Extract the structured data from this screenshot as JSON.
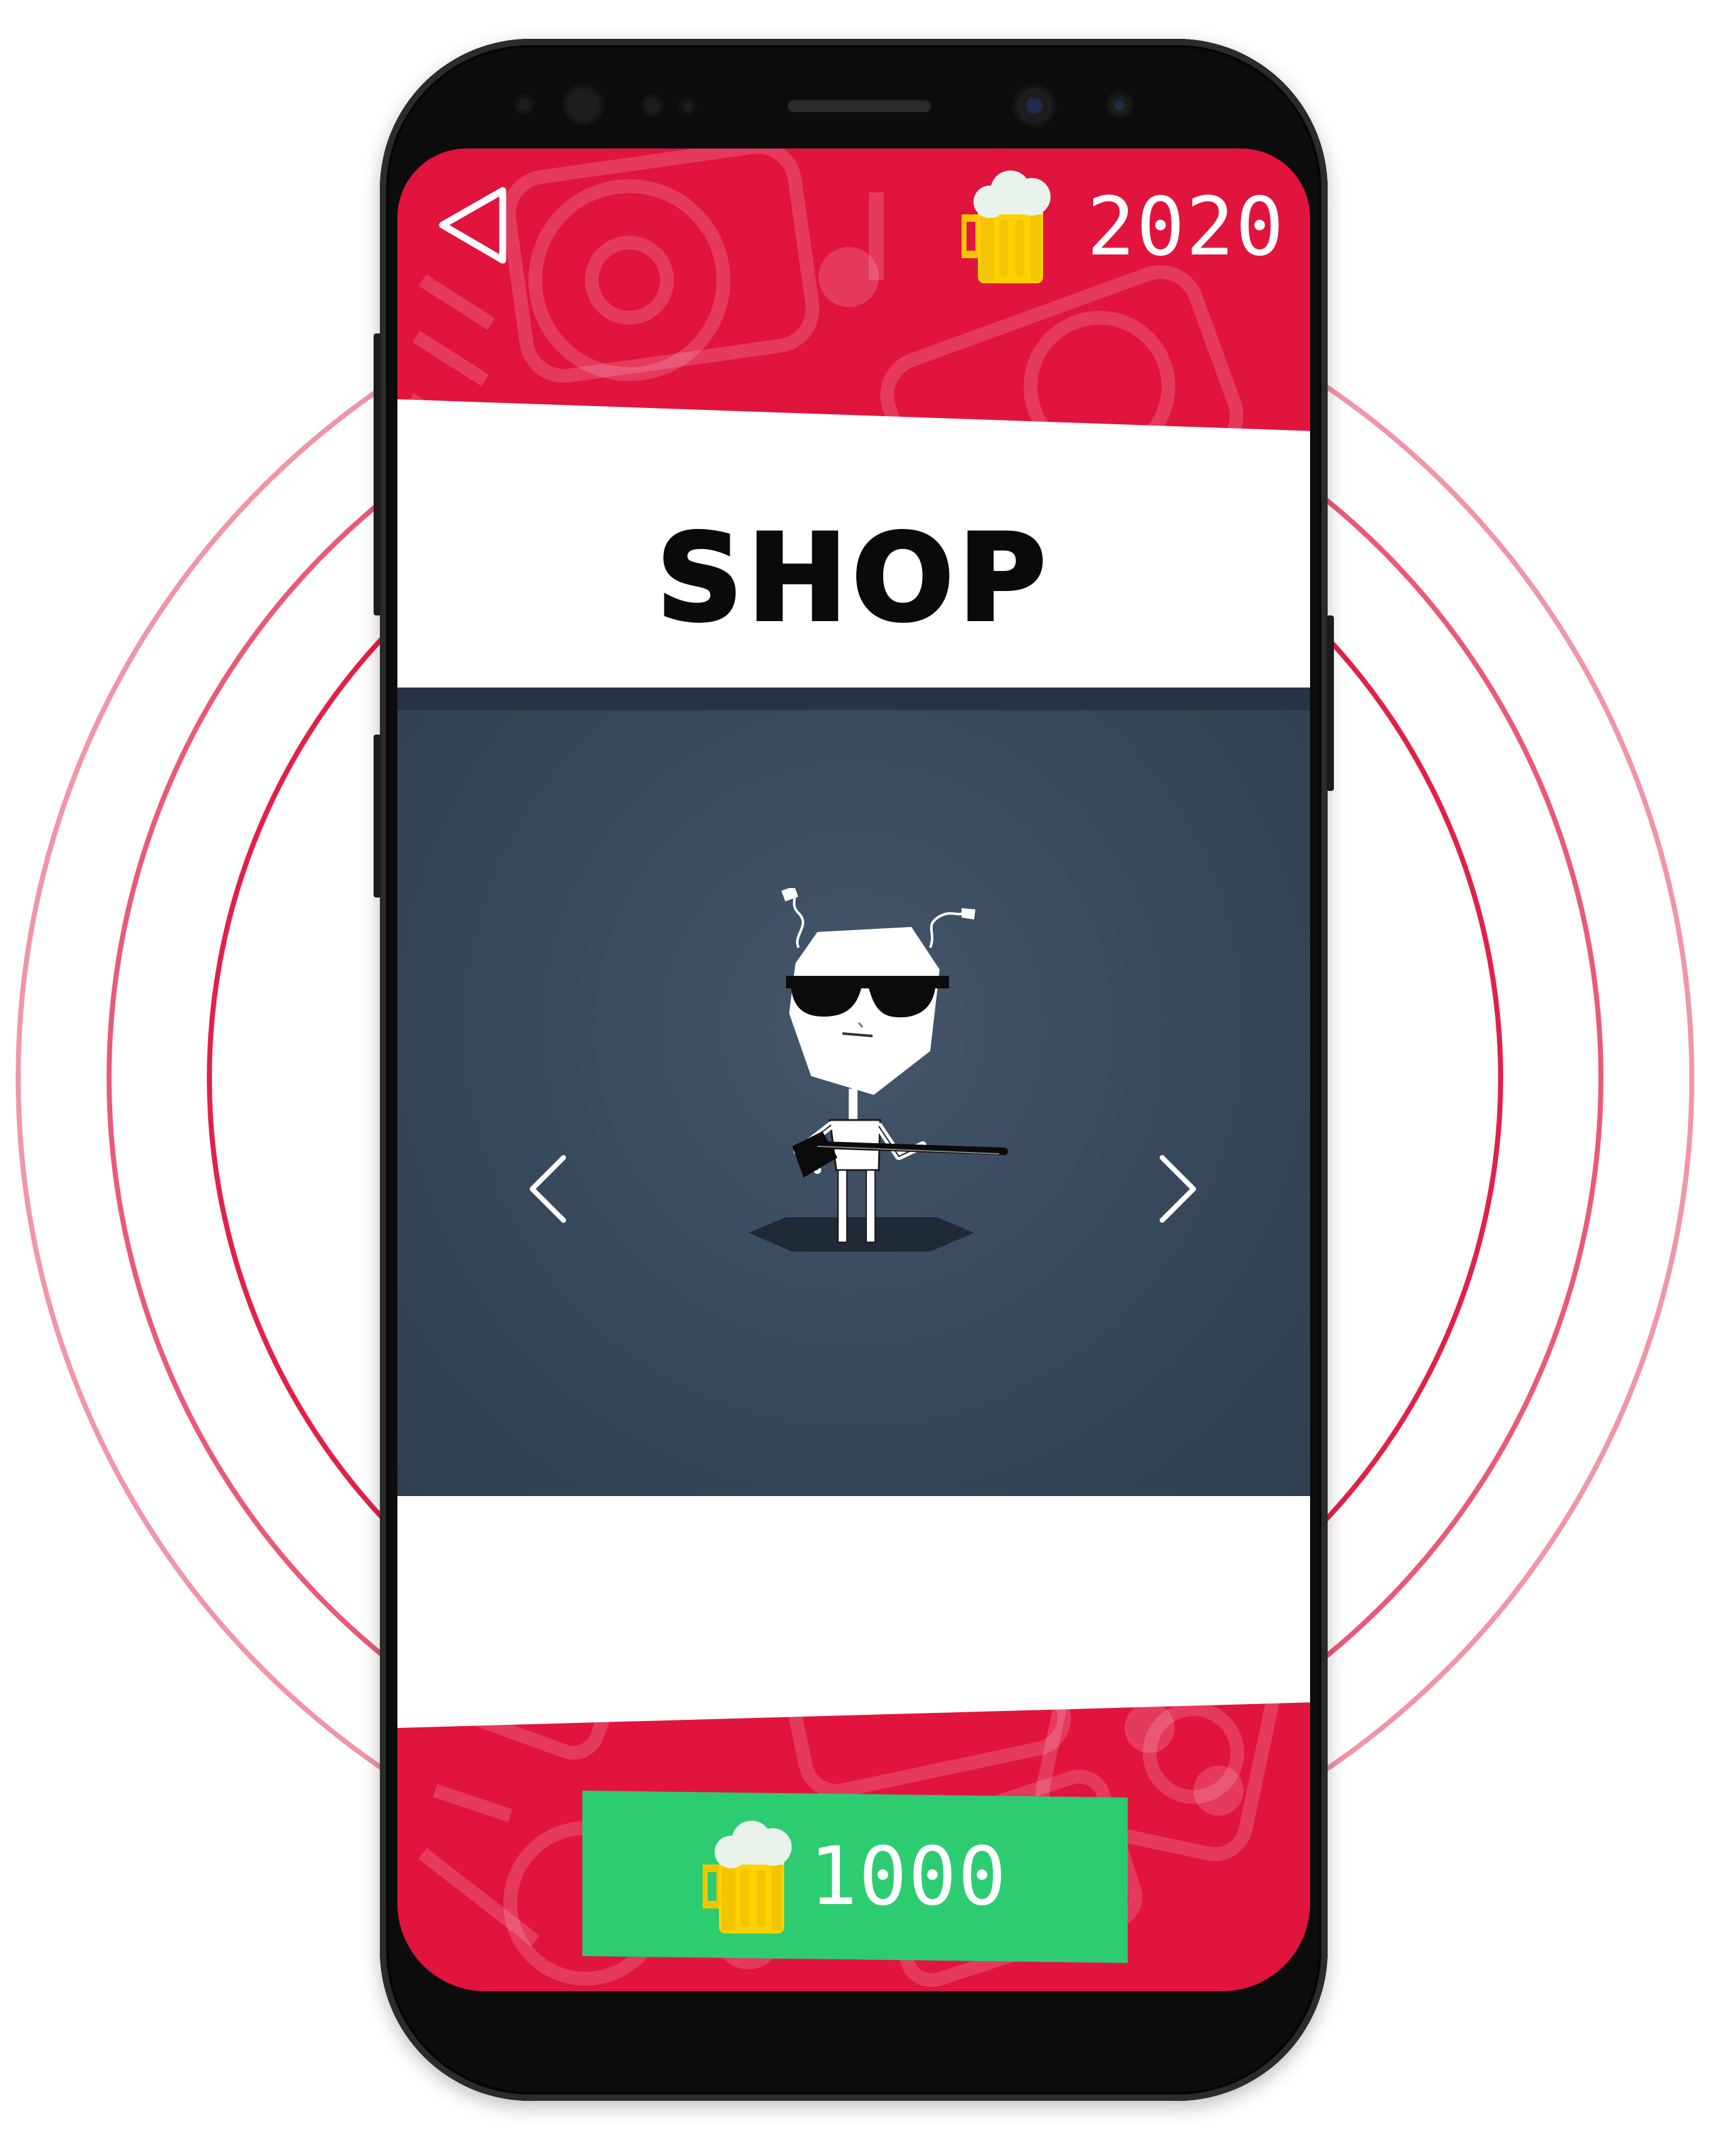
{
  "header": {
    "back_icon": "back-triangle-icon",
    "currency_icon": "beer-mug-icon",
    "balance": "2020"
  },
  "shop": {
    "title": "SHOP"
  },
  "carousel": {
    "prev_icon": "chevron-left-icon",
    "next_icon": "chevron-right-icon",
    "item_icon": "rocker-character-with-guitar"
  },
  "purchase": {
    "price": "1000",
    "currency_icon": "beer-mug-icon"
  },
  "colors": {
    "brand_red": "#e1143e",
    "stage": "#3a4a5e",
    "buy_green": "#2ecc71",
    "phone": "#0c0c0c"
  }
}
